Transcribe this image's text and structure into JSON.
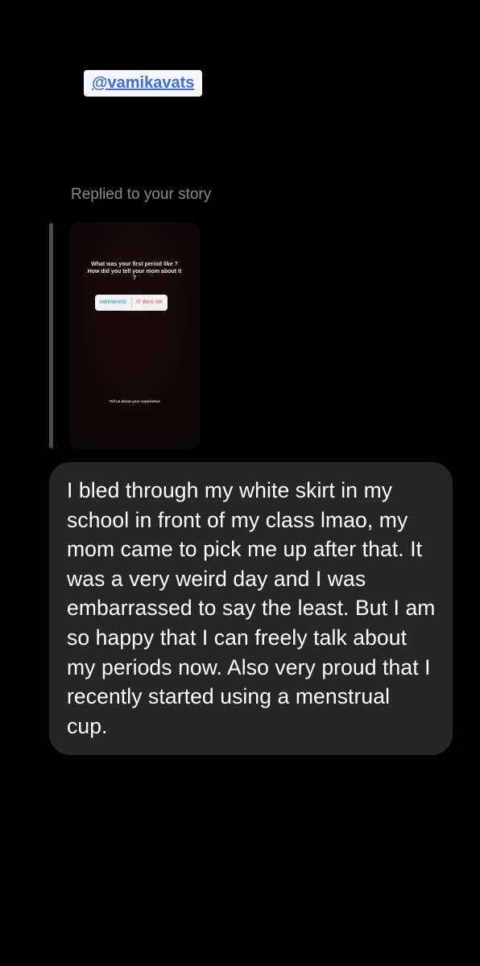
{
  "story_mention": {
    "username": "@vamikavats"
  },
  "reply": {
    "label": "Replied to your story",
    "story": {
      "question": "What was your first period like ? How did you tell your mom about it ?",
      "poll_options": [
        "AWKWARD",
        "IT WAS OK"
      ],
      "footer": "Tell us about your experience"
    }
  },
  "message": {
    "text": "I bled through my white skirt in my school in front of my class lmao, my mom came to pick me up after that. It was a very weird day and I was embarrassed to say the least. But I am so happy that I can freely talk about my periods now. Also very proud that I recently started using a menstrual cup."
  },
  "colors": {
    "background": "#000000",
    "bubble": "#262626",
    "mention_text": "#3d6fd8",
    "mention_bg": "#f4f6fb",
    "secondary_text": "#8a8a8a"
  }
}
